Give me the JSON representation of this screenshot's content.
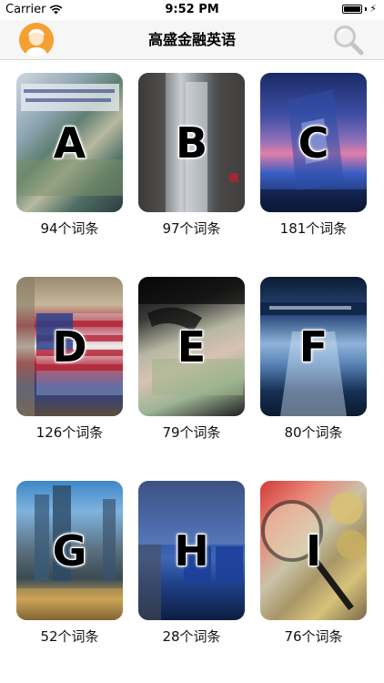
{
  "status_bar": {
    "carrier": "Carrier",
    "time": "9:52 PM"
  },
  "nav": {
    "title": "高盛金融英语"
  },
  "cards": [
    {
      "letter": "A",
      "count": "94个词条"
    },
    {
      "letter": "B",
      "count": "97个词条"
    },
    {
      "letter": "C",
      "count": "181个词条"
    },
    {
      "letter": "D",
      "count": "126个词条"
    },
    {
      "letter": "E",
      "count": "79个词条"
    },
    {
      "letter": "F",
      "count": "80个词条"
    },
    {
      "letter": "G",
      "count": "52个词条"
    },
    {
      "letter": "H",
      "count": "28个词条"
    },
    {
      "letter": "I",
      "count": "76个词条"
    }
  ],
  "colors": {
    "avatar": "#f5a033",
    "nav_background": "#f6f6f6"
  },
  "icons": {
    "avatar": "user-avatar-icon",
    "search": "search-icon",
    "wifi": "wifi-icon",
    "battery": "battery-icon"
  }
}
